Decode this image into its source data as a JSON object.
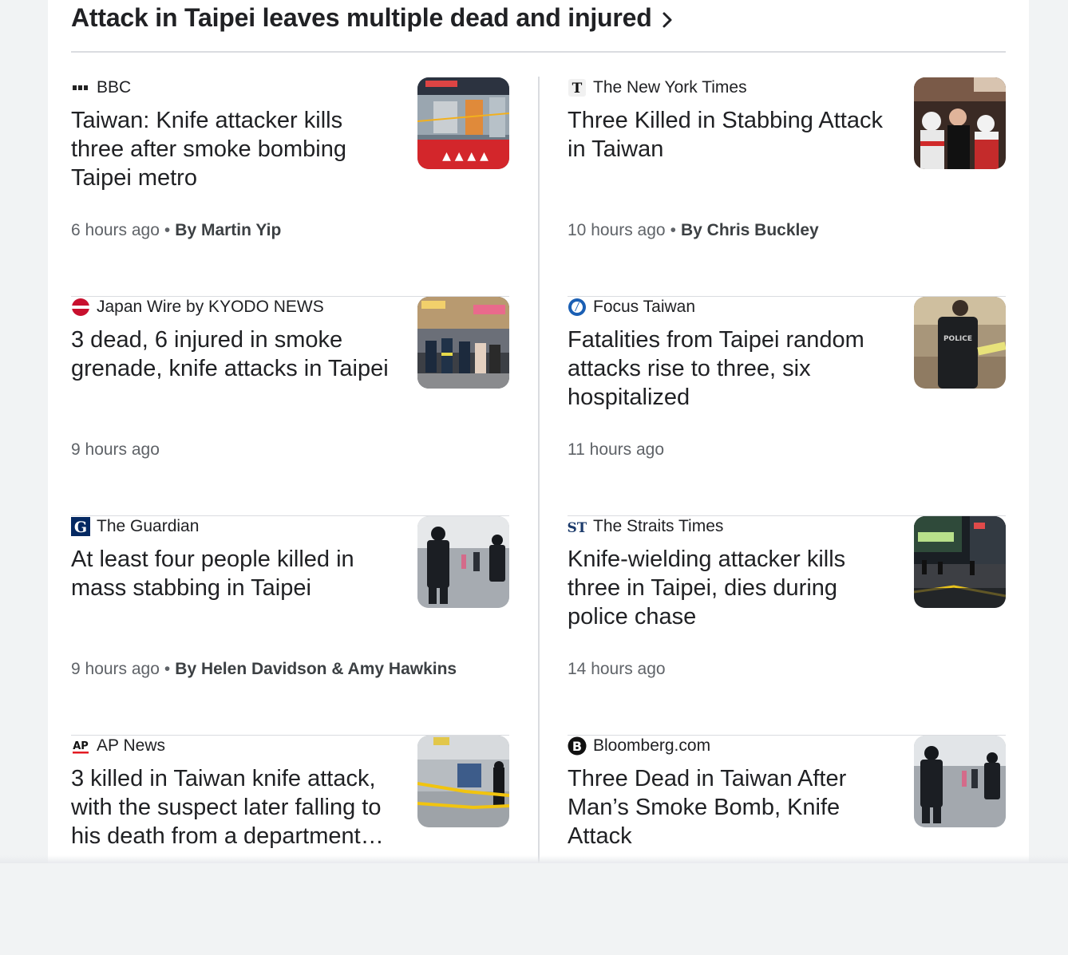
{
  "story": {
    "title": "Attack in Taipei leaves multiple dead and injured"
  },
  "articles": [
    {
      "source": "BBC",
      "source_icon": "bbc-logo",
      "headline": "Taiwan: Knife attacker kills three after smoke bombing Taipei metro",
      "time": "6 hours ago",
      "author": "By Martin Yip",
      "thumb": "metro-station-tape"
    },
    {
      "source": "The New York Times",
      "source_icon": "nyt-logo",
      "headline": "Three Killed in Stabbing Attack in Taiwan",
      "time": "10 hours ago",
      "author": "By Chris Buckley",
      "thumb": "crowd-medics"
    },
    {
      "source": "Japan Wire by KYODO NEWS",
      "source_icon": "kyodo-logo",
      "headline": "3 dead, 6 injured in smoke grenade, knife attacks in Taipei",
      "time": "9 hours ago",
      "author": "",
      "thumb": "firefighters-street"
    },
    {
      "source": "Focus Taiwan",
      "source_icon": "focus-taiwan-logo",
      "headline": "Fatalities from Taipei random attacks rise to three, six hospitalized",
      "time": "11 hours ago",
      "author": "",
      "thumb": "police-officer"
    },
    {
      "source": "The Guardian",
      "source_icon": "guardian-logo",
      "headline": "At least four people killed in mass stabbing in Taipei",
      "time": "9 hours ago",
      "author": "By Helen Davidson & Amy Hawkins",
      "thumb": "armed-police-station"
    },
    {
      "source": "The Straits Times",
      "source_icon": "straits-times-logo",
      "headline": "Knife-wielding attacker kills three in Taipei, dies during police chase",
      "time": "14 hours ago",
      "author": "",
      "thumb": "night-street-police"
    },
    {
      "source": "AP News",
      "source_icon": "ap-logo",
      "headline": "3 killed in Taiwan knife attack, with the suspect later falling to his death from a department…",
      "time": "",
      "author": "",
      "thumb": "cordoned-station"
    },
    {
      "source": "Bloomberg.com",
      "source_icon": "bloomberg-logo",
      "headline": "Three Dead in Taiwan After Man’s Smoke Bomb, Knife Attack",
      "time": "",
      "author": "",
      "thumb": "armed-police-station-2"
    }
  ],
  "colors": {
    "accent": "#1a73e8",
    "divider": "#dadce0",
    "meta": "#5f6368"
  }
}
